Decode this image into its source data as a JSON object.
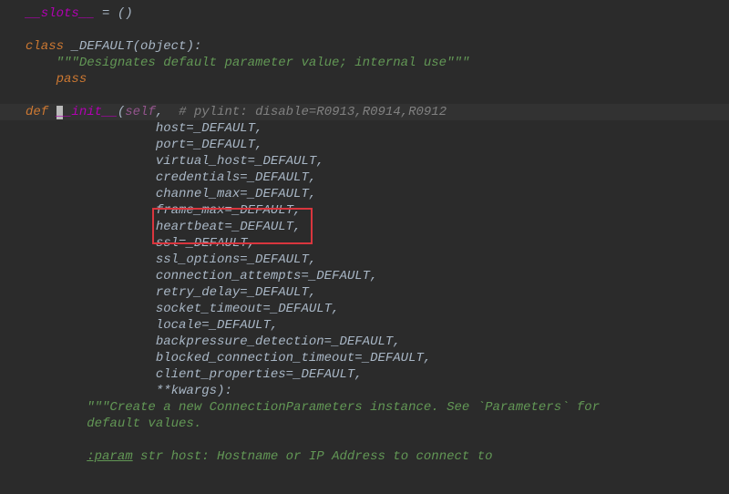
{
  "code": {
    "slots_assign": "__slots__",
    "slots_rest": " = ()",
    "class_kw": "class ",
    "class_name": "_DEFAULT",
    "class_base": "(object):",
    "class_doc": "\"\"\"Designates default parameter value; internal use\"\"\"",
    "pass_kw": "pass",
    "def_kw": "def ",
    "init_name": "__init__",
    "self_kw": "self",
    "self_after": ",  ",
    "pylint_cmt": "# pylint: disable=R0913,R0914,R0912",
    "params": [
      "host=_DEFAULT,",
      "port=_DEFAULT,",
      "virtual_host=_DEFAULT,",
      "credentials=_DEFAULT,",
      "channel_max=_DEFAULT,",
      "frame_max=_DEFAULT,",
      "heartbeat=_DEFAULT,",
      "ssl=_DEFAULT,",
      "ssl_options=_DEFAULT,",
      "connection_attempts=_DEFAULT,",
      "retry_delay=_DEFAULT,",
      "socket_timeout=_DEFAULT,",
      "locale=_DEFAULT,",
      "backpressure_detection=_DEFAULT,",
      "blocked_connection_timeout=_DEFAULT,",
      "client_properties=_DEFAULT,"
    ],
    "kwargs_line": "**kwargs):",
    "ctor_doc1": "\"\"\"Create a new ConnectionParameters instance. See `Parameters` for",
    "ctor_doc2": "default values.",
    "param_tag": ":param",
    "param_rest": " str host: Hostname or IP Address to connect to"
  },
  "highlight_box_param_index": 6
}
